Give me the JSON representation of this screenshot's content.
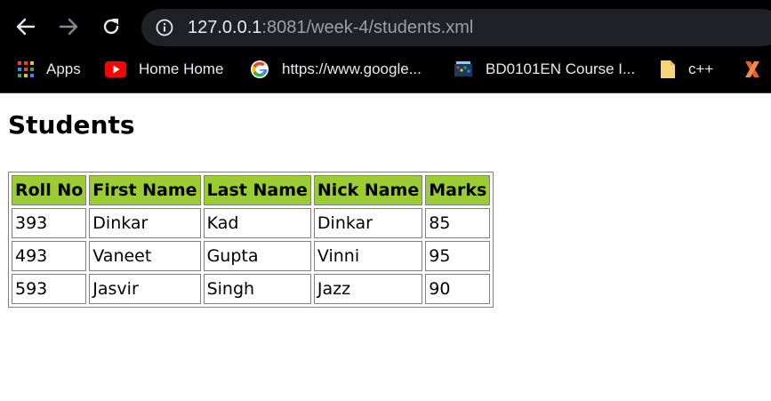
{
  "browser": {
    "url_host": "127.0.0.1",
    "url_rest": ":8081/week-4/students.xml",
    "bookmarks": [
      {
        "label": "Apps",
        "icon": "apps-grid-icon"
      },
      {
        "label": "Home Home",
        "icon": "youtube-icon"
      },
      {
        "label": "https://www.google...",
        "icon": "google-icon"
      },
      {
        "label": "BD0101EN Course I...",
        "icon": "course-icon"
      },
      {
        "label": "c++",
        "icon": "folder-icon"
      },
      {
        "label": "",
        "icon": "x-logo-icon"
      }
    ]
  },
  "page": {
    "title": "Students",
    "table": {
      "headers": [
        "Roll No",
        "First Name",
        "Last Name",
        "Nick Name",
        "Marks"
      ],
      "rows": [
        [
          "393",
          "Dinkar",
          "Kad",
          "Dinkar",
          "85"
        ],
        [
          "493",
          "Vaneet",
          "Gupta",
          "Vinni",
          "95"
        ],
        [
          "593",
          "Jasvir",
          "Singh",
          "Jazz",
          "90"
        ]
      ]
    }
  },
  "colors": {
    "header_bg": "#9acd32",
    "chrome_bg": "#000000",
    "omnibox_bg": "#202124"
  }
}
